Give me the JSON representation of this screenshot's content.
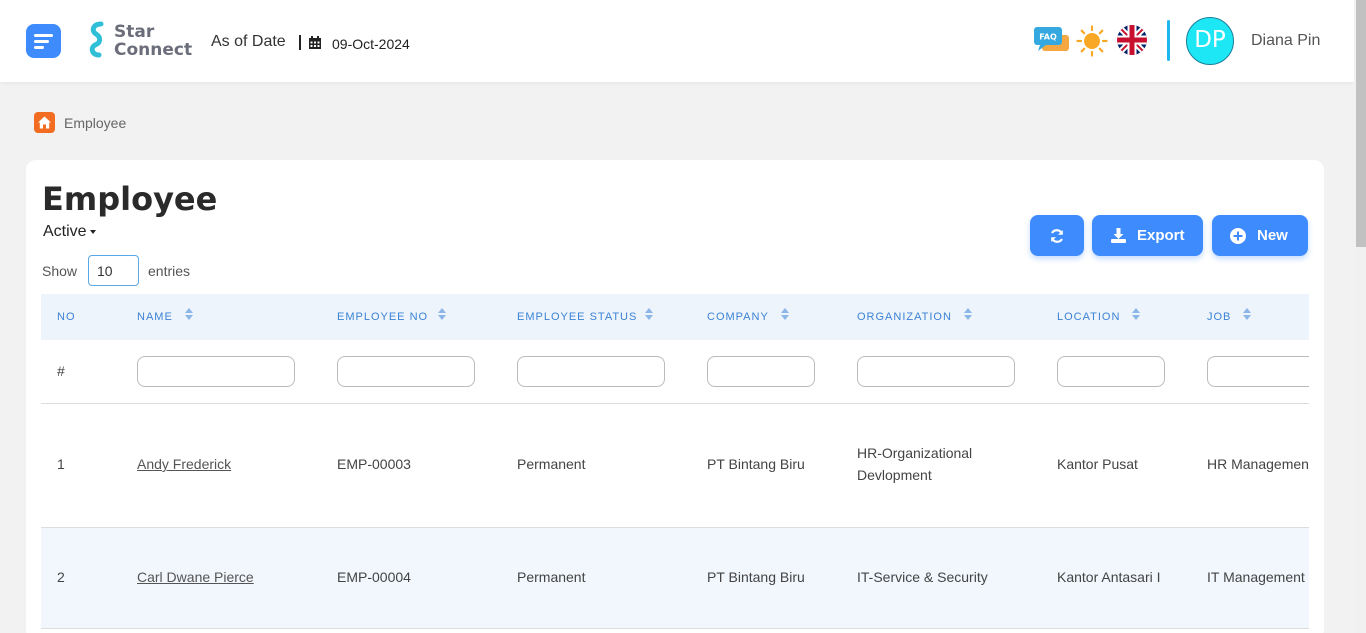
{
  "header": {
    "brand_line1": "Star",
    "brand_line2": "Connect",
    "as_of_label": "As of Date",
    "as_of_date": "09-Oct-2024",
    "faq_label": "FAQ",
    "avatar_initials": "DP",
    "user_name": "Diana Pin"
  },
  "breadcrumb": {
    "current": "Employee"
  },
  "page": {
    "title": "Employee",
    "status_filter": "Active",
    "show_label": "Show",
    "entries_value": "10",
    "entries_label": "entries"
  },
  "toolbar": {
    "export_label": "Export",
    "new_label": "New"
  },
  "table": {
    "columns": [
      "NO",
      "NAME",
      "EMPLOYEE NO",
      "EMPLOYEE STATUS",
      "COMPANY",
      "ORGANIZATION",
      "LOCATION",
      "JOB"
    ],
    "filter_row_marker": "#",
    "rows": [
      {
        "no": "1",
        "name": "Andy Frederick",
        "employee_no": "EMP-00003",
        "status": "Permanent",
        "company": "PT Bintang Biru",
        "organization_l1": "HR-Organizational",
        "organization_l2": "Devlopment",
        "location": "Kantor Pusat",
        "job": "HR Managemen"
      },
      {
        "no": "2",
        "name": "Carl Dwane Pierce",
        "employee_no": "EMP-00004",
        "status": "Permanent",
        "company": "PT Bintang Biru",
        "organization_l1": "IT-Service & Security",
        "organization_l2": "",
        "location": "Kantor Antasari I",
        "job": "IT Management"
      }
    ]
  },
  "colors": {
    "primary": "#3d8bfd",
    "header_text": "#3b82d6",
    "avatar_bg": "#1de6f5",
    "home_icon_bg": "#f26d21",
    "divider": "#1fb6f0"
  }
}
